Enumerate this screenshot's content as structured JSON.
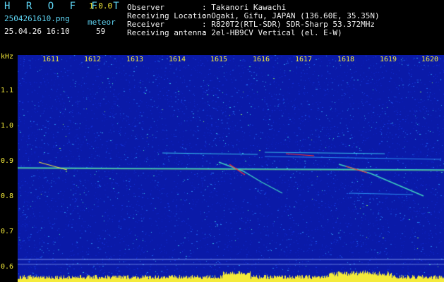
{
  "header": {
    "app_title": "H R O F F T",
    "version": "1.0.0",
    "file_name": "2504261610.png",
    "datetime": "25.04.26 16:10",
    "meteor_label": "meteor",
    "meteor_count": "59",
    "info": [
      {
        "label": "Observer",
        "value": ": Takanori Kawachi"
      },
      {
        "label": "Receiving Location",
        "value": ": Ogaki, Gifu, JAPAN (136.60E, 35.35N)"
      },
      {
        "label": "Receiver",
        "value": ": R820T2(RTL-SDR) SDR-Sharp 53.372MHz"
      },
      {
        "label": "Receiving antenna",
        "value": ": 2el-HB9CV Vertical (el. E-W)"
      }
    ]
  },
  "axis": {
    "y_unit": "kHz",
    "y_ticks": [
      "1.1",
      "1.0",
      "0.9",
      "0.8",
      "0.7",
      "0.6"
    ],
    "x_ticks": [
      "1611",
      "1612",
      "1613",
      "1614",
      "1615",
      "1616",
      "1617",
      "1618",
      "1619",
      "1620"
    ]
  },
  "colors": {
    "header_cyan": "#5fd6f5",
    "header_yellow": "#f4ea3a",
    "background_blue": "#0a1aa8",
    "echo_yellow": "#f4ea3a",
    "echo_red": "#ff3030"
  }
}
